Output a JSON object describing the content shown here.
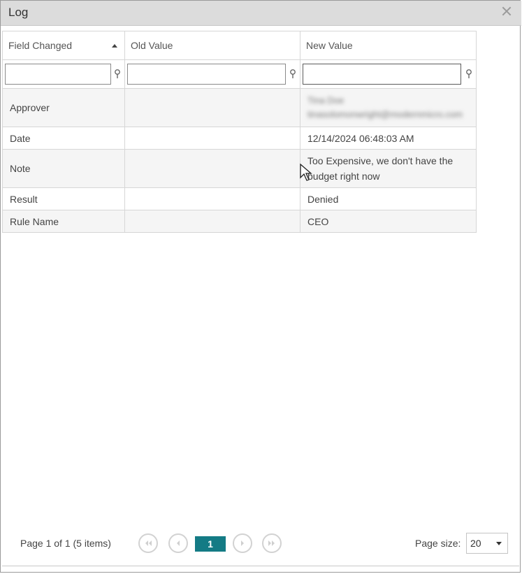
{
  "dialog": {
    "title": "Log"
  },
  "grid": {
    "columns": [
      {
        "label": "Field Changed",
        "sorted": "ascending"
      },
      {
        "label": "Old Value"
      },
      {
        "label": "New Value"
      }
    ],
    "filters": [
      "",
      "",
      ""
    ],
    "rows": [
      {
        "field": "Approver",
        "old": "",
        "new_line1": "Tina Doe",
        "new_line2": "tinasolomonwright@modernmicro.com",
        "new_obscured": true
      },
      {
        "field": "Date",
        "old": "",
        "new": "12/14/2024 06:48:03 AM"
      },
      {
        "field": "Note",
        "old": "",
        "new": "Too Expensive, we don't have the budget right now"
      },
      {
        "field": "Result",
        "old": "",
        "new": "Denied"
      },
      {
        "field": "Rule Name",
        "old": "",
        "new": "CEO"
      }
    ]
  },
  "pager": {
    "info": "Page 1 of 1 (5 items)",
    "current_page": "1",
    "page_size_label": "Page size:",
    "page_size": "20"
  },
  "colors": {
    "accent": "#147b85",
    "title_bar": "#dcdcdc",
    "row_alt": "#f5f5f5"
  }
}
